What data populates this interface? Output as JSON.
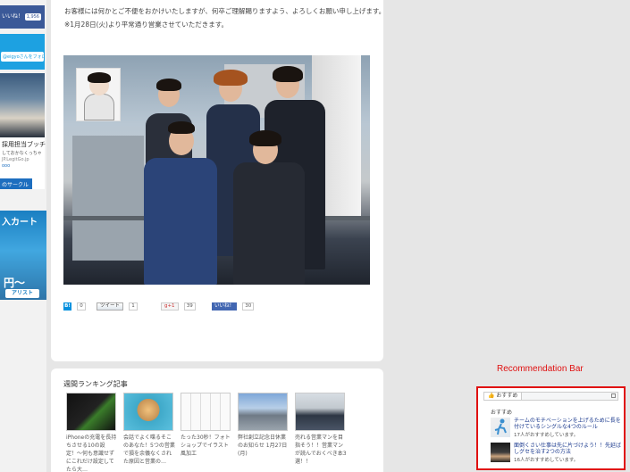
{
  "sidebar": {
    "fb_like_label": "いいね！",
    "fb_like_count": "1,956",
    "twitter_follow": "@eigyoさんをフォロー",
    "person_ad": {
      "name": "採用担当ブッチ",
      "line2": "しておかなくっちゃ",
      "line3": "JP.LegitGo.jp",
      "line4": "ooo"
    },
    "circle_button": "のサークル",
    "banner": {
      "headline": "入カート",
      "sub": "円〜",
      "logo": "アリスト"
    }
  },
  "article": {
    "notice_line1": "お客様には何かとご不便をおかけいたしますが、何卒ご理解賜りますよう、よろしくお願い申し上げます。",
    "notice_line2": "※1月28日(火)より平常通り営業させていただきます。"
  },
  "share": {
    "hatena_label": "B!",
    "hatena_count": "0",
    "tweet_label": "ツイート",
    "tweet_count": "1",
    "gplus_label": "g+1",
    "gplus_count": "39",
    "fb_like_label": "いいね！",
    "fb_like_count": "30"
  },
  "ranking": {
    "title": "週間ランキング記事",
    "items": [
      {
        "caption": "iPhoneの充電を長持ちさせる10の設定！〜何も意識せずにこれだけ設定してたら大…"
      },
      {
        "caption": "会話でよく喋るそこのあなた！5つの営業で損を余儀なくされた原因と営業の…"
      },
      {
        "caption": "たった30秒！フォトショップでイラスト風加工"
      },
      {
        "caption": "弊社創立記念日休業のお知らせ 1月27日(月)"
      },
      {
        "caption": "売れる営業マンを目指そう！！営業マンが読んでおくべき本3選！！"
      }
    ]
  },
  "recommendation": {
    "label": "Recommendation  Bar",
    "tab": "おすすめ",
    "subtitle": "おすすめ",
    "items": [
      {
        "title": "チームのモチベーションを上げるために長を付けているシングルな4つのルール",
        "meta": "17人がおすすめしています。"
      },
      {
        "title": "面倒くさい仕事は先に片づけよう！！先延ばしグセを治す2つの方法",
        "meta": "16人がおすすめしています。"
      }
    ]
  },
  "colors": {
    "accent_red": "#e01010",
    "facebook_blue": "#3b5998",
    "twitter_blue": "#1da1e1"
  }
}
